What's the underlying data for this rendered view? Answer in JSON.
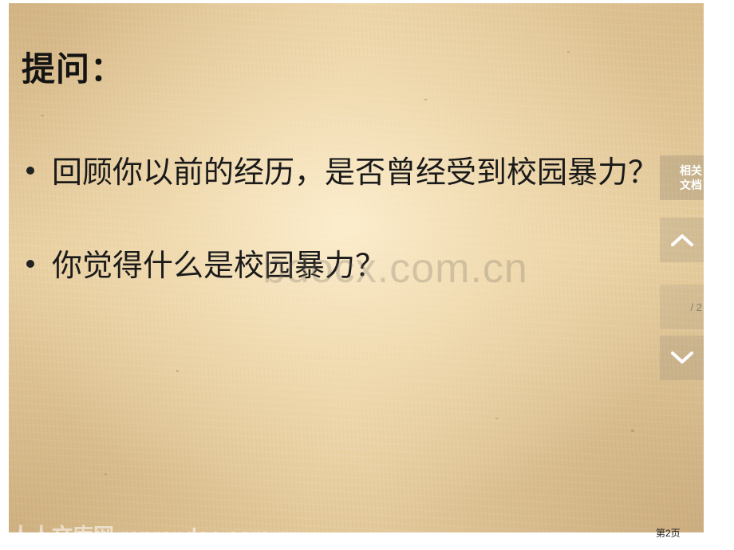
{
  "slide": {
    "title": "提问：",
    "bullets": [
      "回顾你以前的经历，是否曾经受到校园暴力？",
      "你觉得什么是校园暴力？"
    ],
    "watermark": "bdocx.com.cn",
    "bottom_watermark": "人人文库网 renrendoc.com"
  },
  "side_panel": {
    "related_label_line1": "相关",
    "related_label_line2": "文档",
    "up_icon": "chevron-up-icon",
    "down_icon": "chevron-down-icon",
    "page_indicator": "/ 2"
  },
  "footer": {
    "page_label": "第2页"
  },
  "colors": {
    "paper": "#e8cfa0",
    "text": "#1a1a1a",
    "panel_icon": "#ffffff"
  }
}
